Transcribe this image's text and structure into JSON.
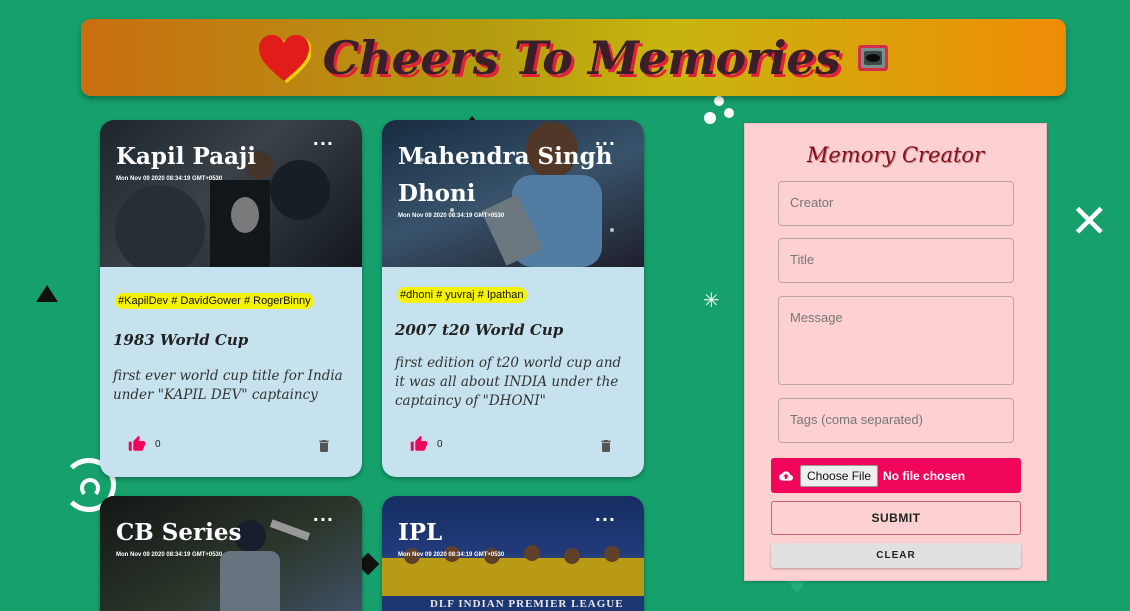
{
  "header": {
    "title": "Cheers To Memories",
    "heart_icon": "heart-icon",
    "camera_icon": "camera-icon"
  },
  "cards": [
    {
      "title": "Kapil Paaji",
      "date": "Mon Nov 09 2020 08:34:19 GMT+0530",
      "tags": "#KapilDev # DavidGower # RogerBinny",
      "memory_title": "1983 World Cup",
      "message": "first ever world cup title for India under \"KAPIL DEV\" captaincy",
      "likes": "0",
      "image_colors": [
        "#2c3a44",
        "#5a6670",
        "#1d262d"
      ]
    },
    {
      "title": "Mahendra Singh Dhoni",
      "date": "Mon Nov 09 2020 08:34:19 GMT+0530",
      "tags": "#dhoni # yuvraj # Ipathan",
      "memory_title": "2007 t20 World Cup",
      "message": "first edition of t20 world cup and it was all about INDIA under the captaincy of \"DHONI\"",
      "likes": "0",
      "image_colors": [
        "#1f3a56",
        "#4b6f8f",
        "#2a2a3a"
      ]
    },
    {
      "title": "CB Series",
      "date": "Mon Nov 09 2020 08:34:19 GMT+0530",
      "image_colors": [
        "#1a1f1c",
        "#3b4a3a",
        "#5a7090"
      ]
    },
    {
      "title": "IPL",
      "date": "Mon Nov 09 2020 08:34:19 GMT+0530",
      "banner": "DLF INDIAN PREMIER LEAGUE",
      "image_colors": [
        "#1c3a7a",
        "#e8c020",
        "#2a4a9a"
      ]
    }
  ],
  "form": {
    "heading": "Memory Creator",
    "creator_placeholder": "Creator",
    "title_placeholder": "Title",
    "message_placeholder": "Message",
    "tags_placeholder": "Tags (coma separated)",
    "choose_file_label": "Choose File",
    "file_status": "No file chosen",
    "submit_label": "SUBMIT",
    "clear_label": "CLEAR"
  },
  "colors": {
    "background": "#16a06c",
    "like": "#f0055b",
    "tag_highlight": "#f5f207",
    "form_bg": "#fdd0d2"
  }
}
